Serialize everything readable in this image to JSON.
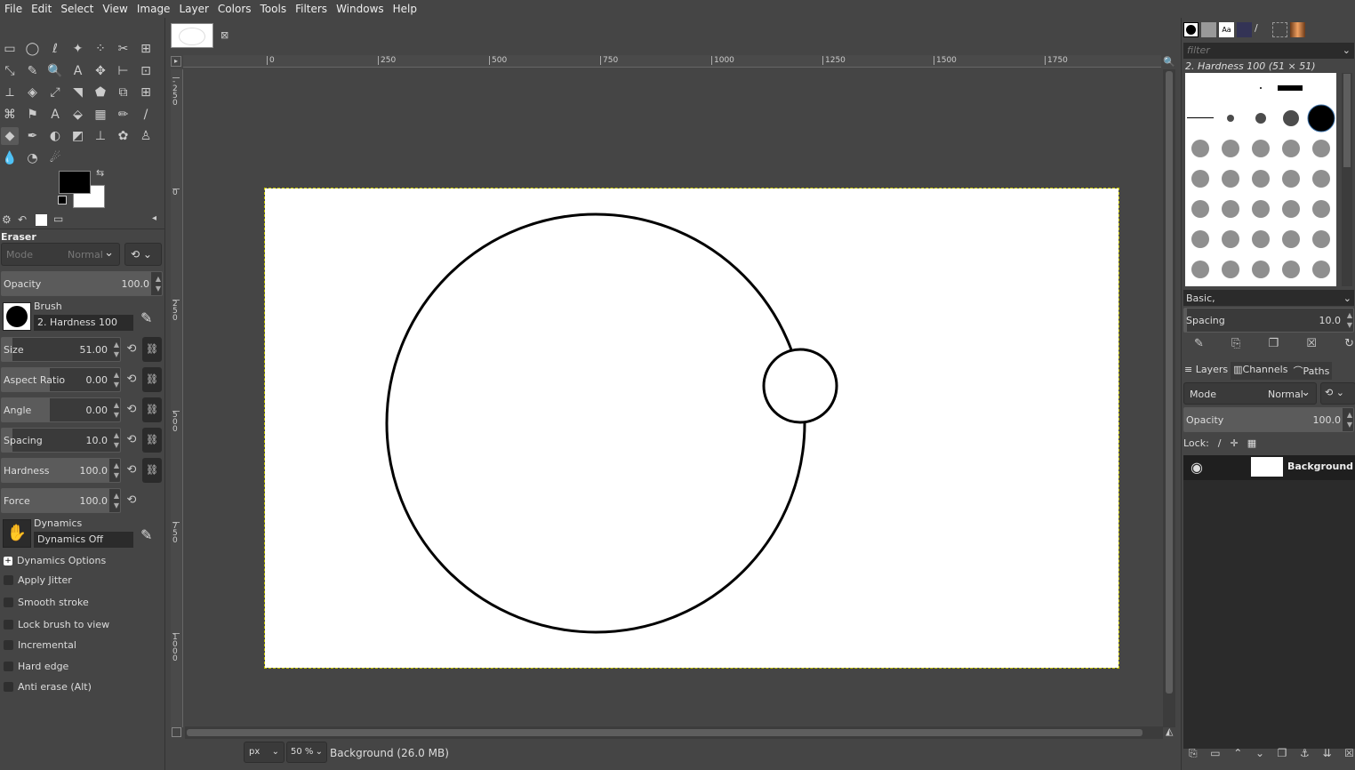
{
  "menu": [
    "File",
    "Edit",
    "Select",
    "View",
    "Image",
    "Layer",
    "Colors",
    "Tools",
    "Filters",
    "Windows",
    "Help"
  ],
  "tool_options": {
    "title": "Eraser",
    "mode_label": "Mode",
    "mode_value": "Normal",
    "opacity_label": "Opacity",
    "opacity_value": "100.0",
    "brush_label": "Brush",
    "brush_value": "2. Hardness 100",
    "sliders": [
      {
        "label": "Size",
        "value": "51.00",
        "fraction": 0.1
      },
      {
        "label": "Aspect Ratio",
        "value": "0.00",
        "fraction": 0.45
      },
      {
        "label": "Angle",
        "value": "0.00",
        "fraction": 0.45
      },
      {
        "label": "Spacing",
        "value": "10.0",
        "fraction": 0.1
      },
      {
        "label": "Hardness",
        "value": "100.0",
        "fraction": 1.0
      },
      {
        "label": "Force",
        "value": "100.0",
        "fraction": 1.0
      }
    ],
    "dynamics_label": "Dynamics",
    "dynamics_value": "Dynamics Off",
    "dynamics_options": "Dynamics Options",
    "checkboxes": [
      "Apply Jitter",
      "Smooth stroke",
      "Lock brush to view",
      "Incremental",
      "Hard edge",
      "Anti erase  (Alt)"
    ]
  },
  "rulers": {
    "h": [
      "0",
      "250",
      "500",
      "750",
      "1000",
      "1250",
      "1500",
      "1750"
    ],
    "v": [
      "-250",
      "0",
      "250",
      "500",
      "750",
      "1000"
    ]
  },
  "status": {
    "unit": "px",
    "zoom": "50 %",
    "info": "Background (26.0 MB)"
  },
  "brushes": {
    "filter_placeholder": "filter",
    "current": "2. Hardness 100 (51 × 51)",
    "tag": "Basic,",
    "spacing_label": "Spacing",
    "spacing_value": "10.0"
  },
  "layers": {
    "tabs": [
      "Layers",
      "Channels",
      "Paths"
    ],
    "mode_label": "Mode",
    "mode_value": "Normal",
    "opacity_label": "Opacity",
    "opacity_value": "100.0",
    "lock_label": "Lock:",
    "items": [
      {
        "name": "Background"
      }
    ]
  }
}
